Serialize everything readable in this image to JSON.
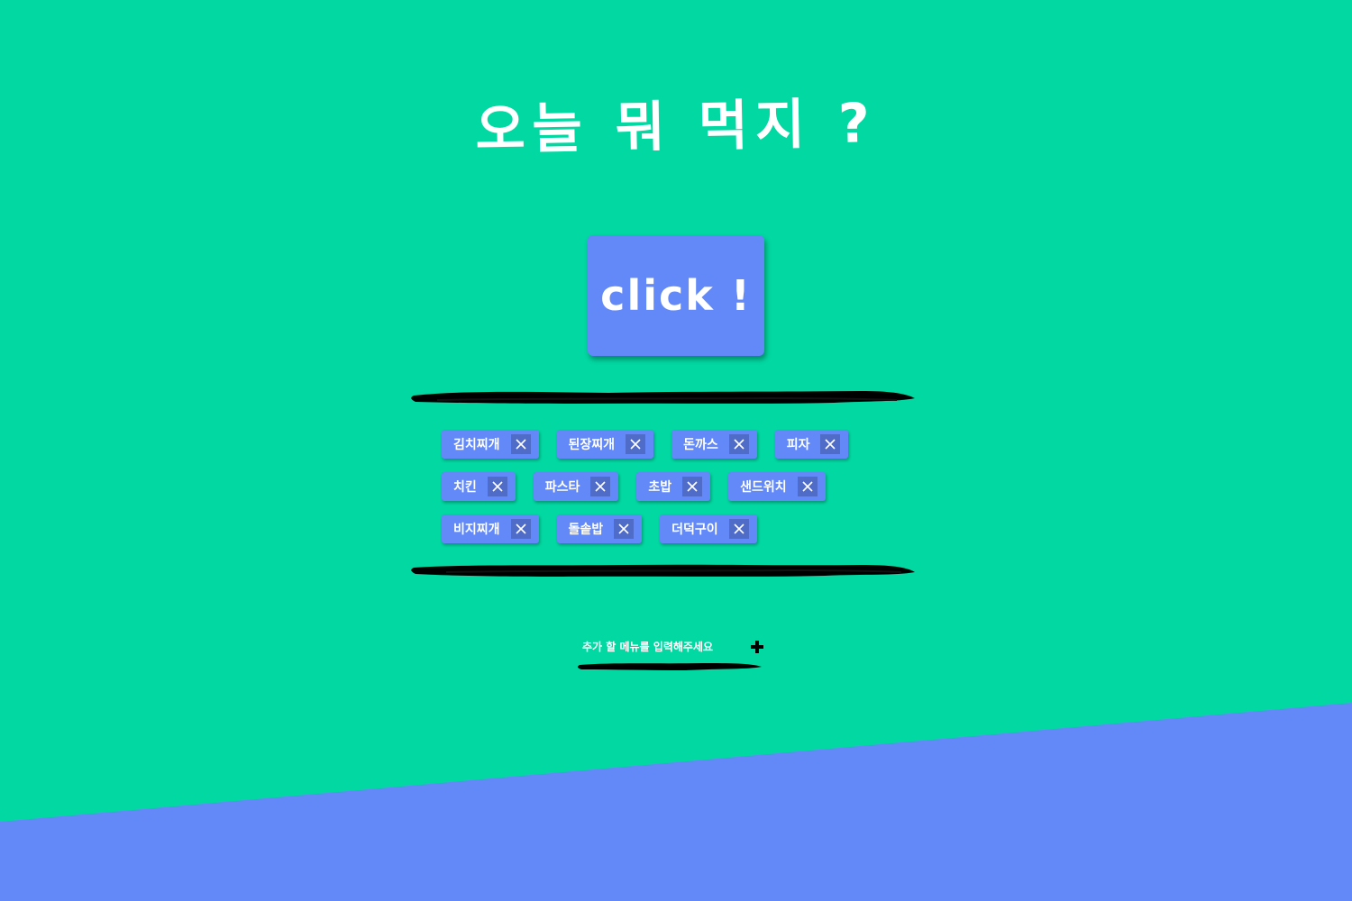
{
  "page": {
    "title": "오늘 뭐 먹지 ?"
  },
  "main": {
    "click_button_label": "click !"
  },
  "menu": {
    "rows": [
      [
        {
          "label": "김치찌개",
          "remove_icon": "close-icon"
        },
        {
          "label": "된장찌개",
          "remove_icon": "close-icon"
        },
        {
          "label": "돈까스",
          "remove_icon": "close-icon"
        },
        {
          "label": "피자",
          "remove_icon": "close-icon"
        }
      ],
      [
        {
          "label": "치킨",
          "remove_icon": "close-icon"
        },
        {
          "label": "파스타",
          "remove_icon": "close-icon"
        },
        {
          "label": "초밥",
          "remove_icon": "close-icon"
        },
        {
          "label": "샌드위치",
          "remove_icon": "close-icon"
        }
      ],
      [
        {
          "label": "비지찌개",
          "remove_icon": "close-icon"
        },
        {
          "label": "돌솥밥",
          "remove_icon": "close-icon"
        },
        {
          "label": "더덕구이",
          "remove_icon": "close-icon"
        }
      ]
    ]
  },
  "add_menu": {
    "placeholder": "추가 할 메뉴를 입력해주세요",
    "value": "",
    "add_icon": "plus-icon"
  },
  "colors": {
    "background": "#02d8a2",
    "accent": "#6389f8",
    "tag_close_bg": "#4f6cc9",
    "brush": "#000000",
    "text": "#ffffff"
  }
}
